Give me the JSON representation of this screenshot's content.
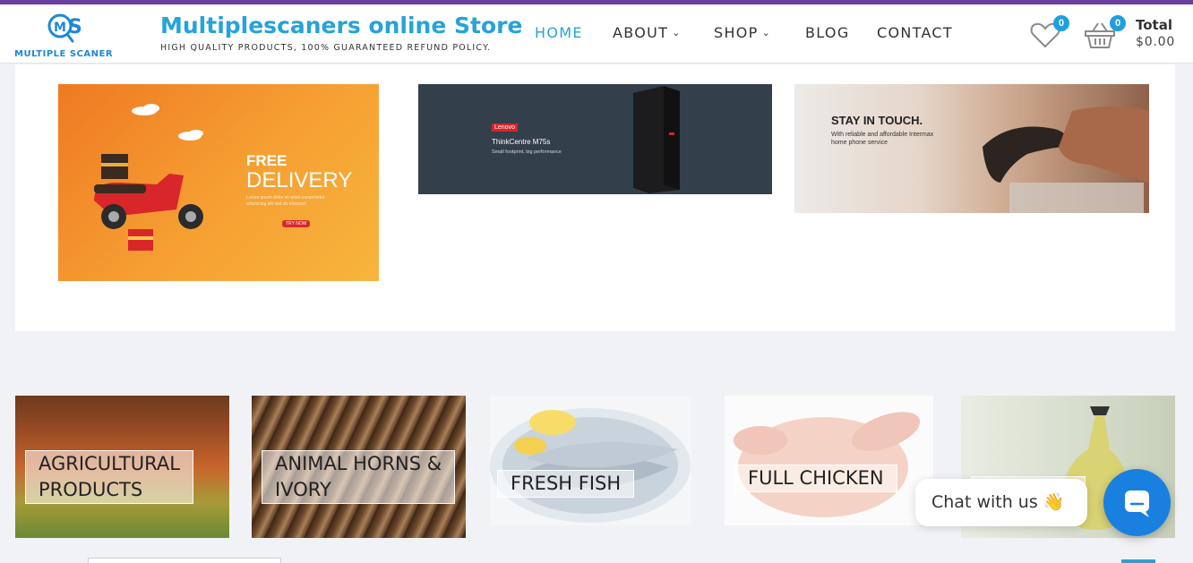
{
  "header": {
    "logo_text": "MULTIPLE SCANER",
    "brand_title": "Multiplescaners online Store",
    "brand_tagline": "HIGH QUALITY PRODUCTS, 100% GUARANTEED REFUND POLICY."
  },
  "nav": {
    "items": [
      {
        "label": "HOME",
        "active": true,
        "has_dropdown": false
      },
      {
        "label": "ABOUT",
        "active": false,
        "has_dropdown": true
      },
      {
        "label": "SHOP",
        "active": false,
        "has_dropdown": true
      },
      {
        "label": "BLOG",
        "active": false,
        "has_dropdown": false
      },
      {
        "label": "CONTACT",
        "active": false,
        "has_dropdown": false
      }
    ],
    "dropdown_glyph": "⌄"
  },
  "wishlist": {
    "icon": "heart-icon",
    "count": "0"
  },
  "cart": {
    "icon": "basket-icon",
    "count": "0",
    "total_label": "Total",
    "total_value": "$0.00"
  },
  "banners": {
    "delivery": {
      "line1": "FREE",
      "line2": "DELIVERY",
      "fine_print": "Lorem ipsum dolor sit amet consectetur adipiscing elit sed do eiusmod",
      "button": "TRY NOW"
    },
    "lenovo": {
      "brand": "Lenovo",
      "model": "ThinkCentre M75s",
      "tagline": "Small footprint, big performance"
    },
    "phone": {
      "title": "STAY IN TOUCH.",
      "subtitle": "With reliable and affordable Intermax home phone service"
    }
  },
  "categories": [
    {
      "label_line1": "AGRICULTURAL",
      "label_line2": "PRODUCTS"
    },
    {
      "label_line1": "ANIMAL HORNS &",
      "label_line2": "IVORY"
    },
    {
      "label_line1": "FRESH FISH",
      "label_line2": ""
    },
    {
      "label_line1": "FULL CHICKEN",
      "label_line2": ""
    },
    {
      "label_line1": "",
      "label_line2": ""
    }
  ],
  "chat": {
    "label": "Chat with us",
    "emoji": "👋",
    "icon": "chat-bubble-icon"
  },
  "colors": {
    "accent": "#26a3d8",
    "badge": "#1fa0dd",
    "topbar": "#6b3fa0",
    "chat_button": "#1a80e0"
  }
}
